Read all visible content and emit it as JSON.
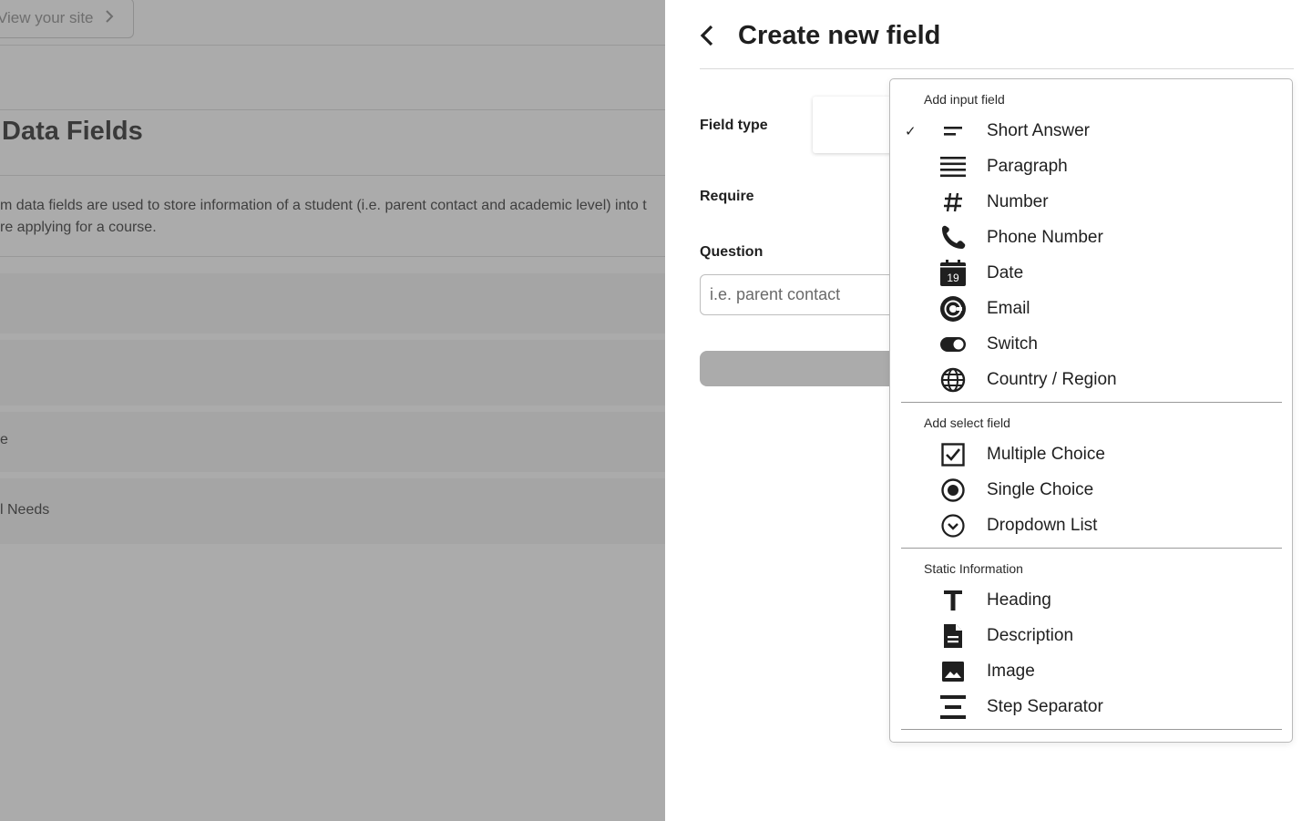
{
  "background": {
    "view_site_label": "View your site",
    "section_title": "Data Fields",
    "description_line1": "m data fields are used to store information of a student (i.e. parent contact and academic level) into t",
    "description_line2": "re applying for a course.",
    "snippet_1": "e",
    "snippet_2": "l Needs"
  },
  "panel": {
    "title": "Create new field",
    "field_type_label": "Field type",
    "require_label": "Require",
    "question_label": "Question",
    "question_placeholder": "i.e. parent contact"
  },
  "dropdown": {
    "groups": [
      {
        "title": "Add input field",
        "items": [
          {
            "label": "Short Answer",
            "icon": "short-answer-icon",
            "selected": true
          },
          {
            "label": "Paragraph",
            "icon": "paragraph-icon"
          },
          {
            "label": "Number",
            "icon": "hash-icon"
          },
          {
            "label": "Phone Number",
            "icon": "phone-icon"
          },
          {
            "label": "Date",
            "icon": "calendar-icon",
            "icon_text": "19"
          },
          {
            "label": "Email",
            "icon": "at-sign-icon"
          },
          {
            "label": "Switch",
            "icon": "toggle-icon"
          },
          {
            "label": "Country / Region",
            "icon": "globe-icon"
          }
        ]
      },
      {
        "title": "Add select field",
        "items": [
          {
            "label": "Multiple Choice",
            "icon": "checkbox-icon"
          },
          {
            "label": "Single Choice",
            "icon": "radio-icon"
          },
          {
            "label": "Dropdown List",
            "icon": "dropdown-circle-icon"
          }
        ]
      },
      {
        "title": "Static Information",
        "items": [
          {
            "label": "Heading",
            "icon": "heading-t-icon"
          },
          {
            "label": "Description",
            "icon": "document-icon"
          },
          {
            "label": "Image",
            "icon": "image-icon"
          },
          {
            "label": "Step Separator",
            "icon": "step-separator-icon"
          }
        ]
      }
    ],
    "check_glyph": "✓"
  },
  "colors": {
    "overlay": "#ababab",
    "text": "#1f1f1f",
    "border": "#b9b9b9"
  }
}
